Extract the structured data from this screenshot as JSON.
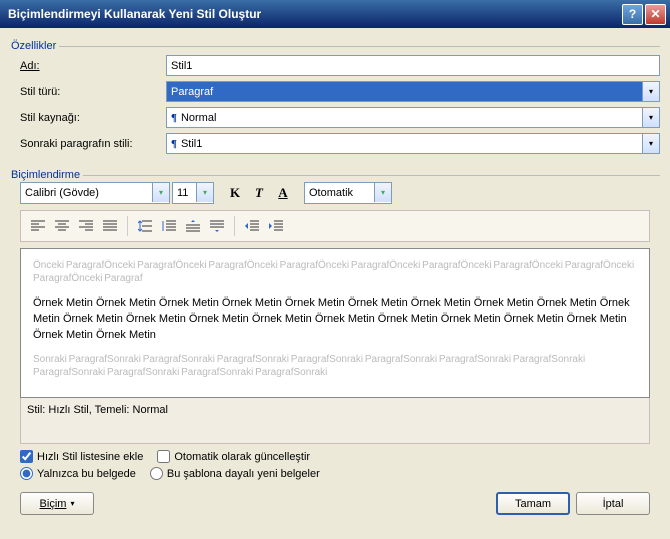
{
  "title": "Biçimlendirmeyi Kullanarak Yeni Stil Oluştur",
  "groups": {
    "props": "Özellikler",
    "fmt": "Biçimlendirme"
  },
  "labels": {
    "name": "Adı:",
    "type": "Stil türü:",
    "source": "Stil kaynağı:",
    "next": "Sonraki paragrafın stili:"
  },
  "values": {
    "name": "Stil1",
    "type": "Paragraf",
    "source": "Normal",
    "next": "Stil1"
  },
  "fmt": {
    "font": "Calibri (Gövde)",
    "size": "11",
    "color": "Otomatik"
  },
  "preview": {
    "before": "Önceki ParagrafÖnceki ParagrafÖnceki ParagrafÖnceki ParagrafÖnceki ParagrafÖnceki ParagrafÖnceki ParagrafÖnceki ParagrafÖnceki ParagrafÖnceki Paragraf",
    "main": "Örnek Metin Örnek Metin Örnek Metin Örnek Metin Örnek Metin Örnek Metin Örnek Metin Örnek Metin Örnek Metin Örnek Metin Örnek Metin Örnek Metin Örnek Metin Örnek Metin Örnek Metin Örnek Metin Örnek Metin Örnek Metin Örnek Metin Örnek Metin Örnek Metin",
    "after": "Sonraki ParagrafSonraki ParagrafSonraki ParagrafSonraki ParagrafSonraki ParagrafSonraki ParagrafSonraki ParagrafSonraki ParagrafSonraki ParagrafSonraki ParagrafSonraki ParagrafSonraki"
  },
  "summary": "Stil: Hızlı Stil, Temeli: Normal",
  "checks": {
    "quick": "Hızlı Stil listesine ekle",
    "auto": "Otomatik olarak güncelleştir",
    "docOnly": "Yalnızca bu belgede",
    "template": "Bu şablona dayalı yeni belgeler"
  },
  "buttons": {
    "format": "Biçim",
    "ok": "Tamam",
    "cancel": "İptal"
  }
}
